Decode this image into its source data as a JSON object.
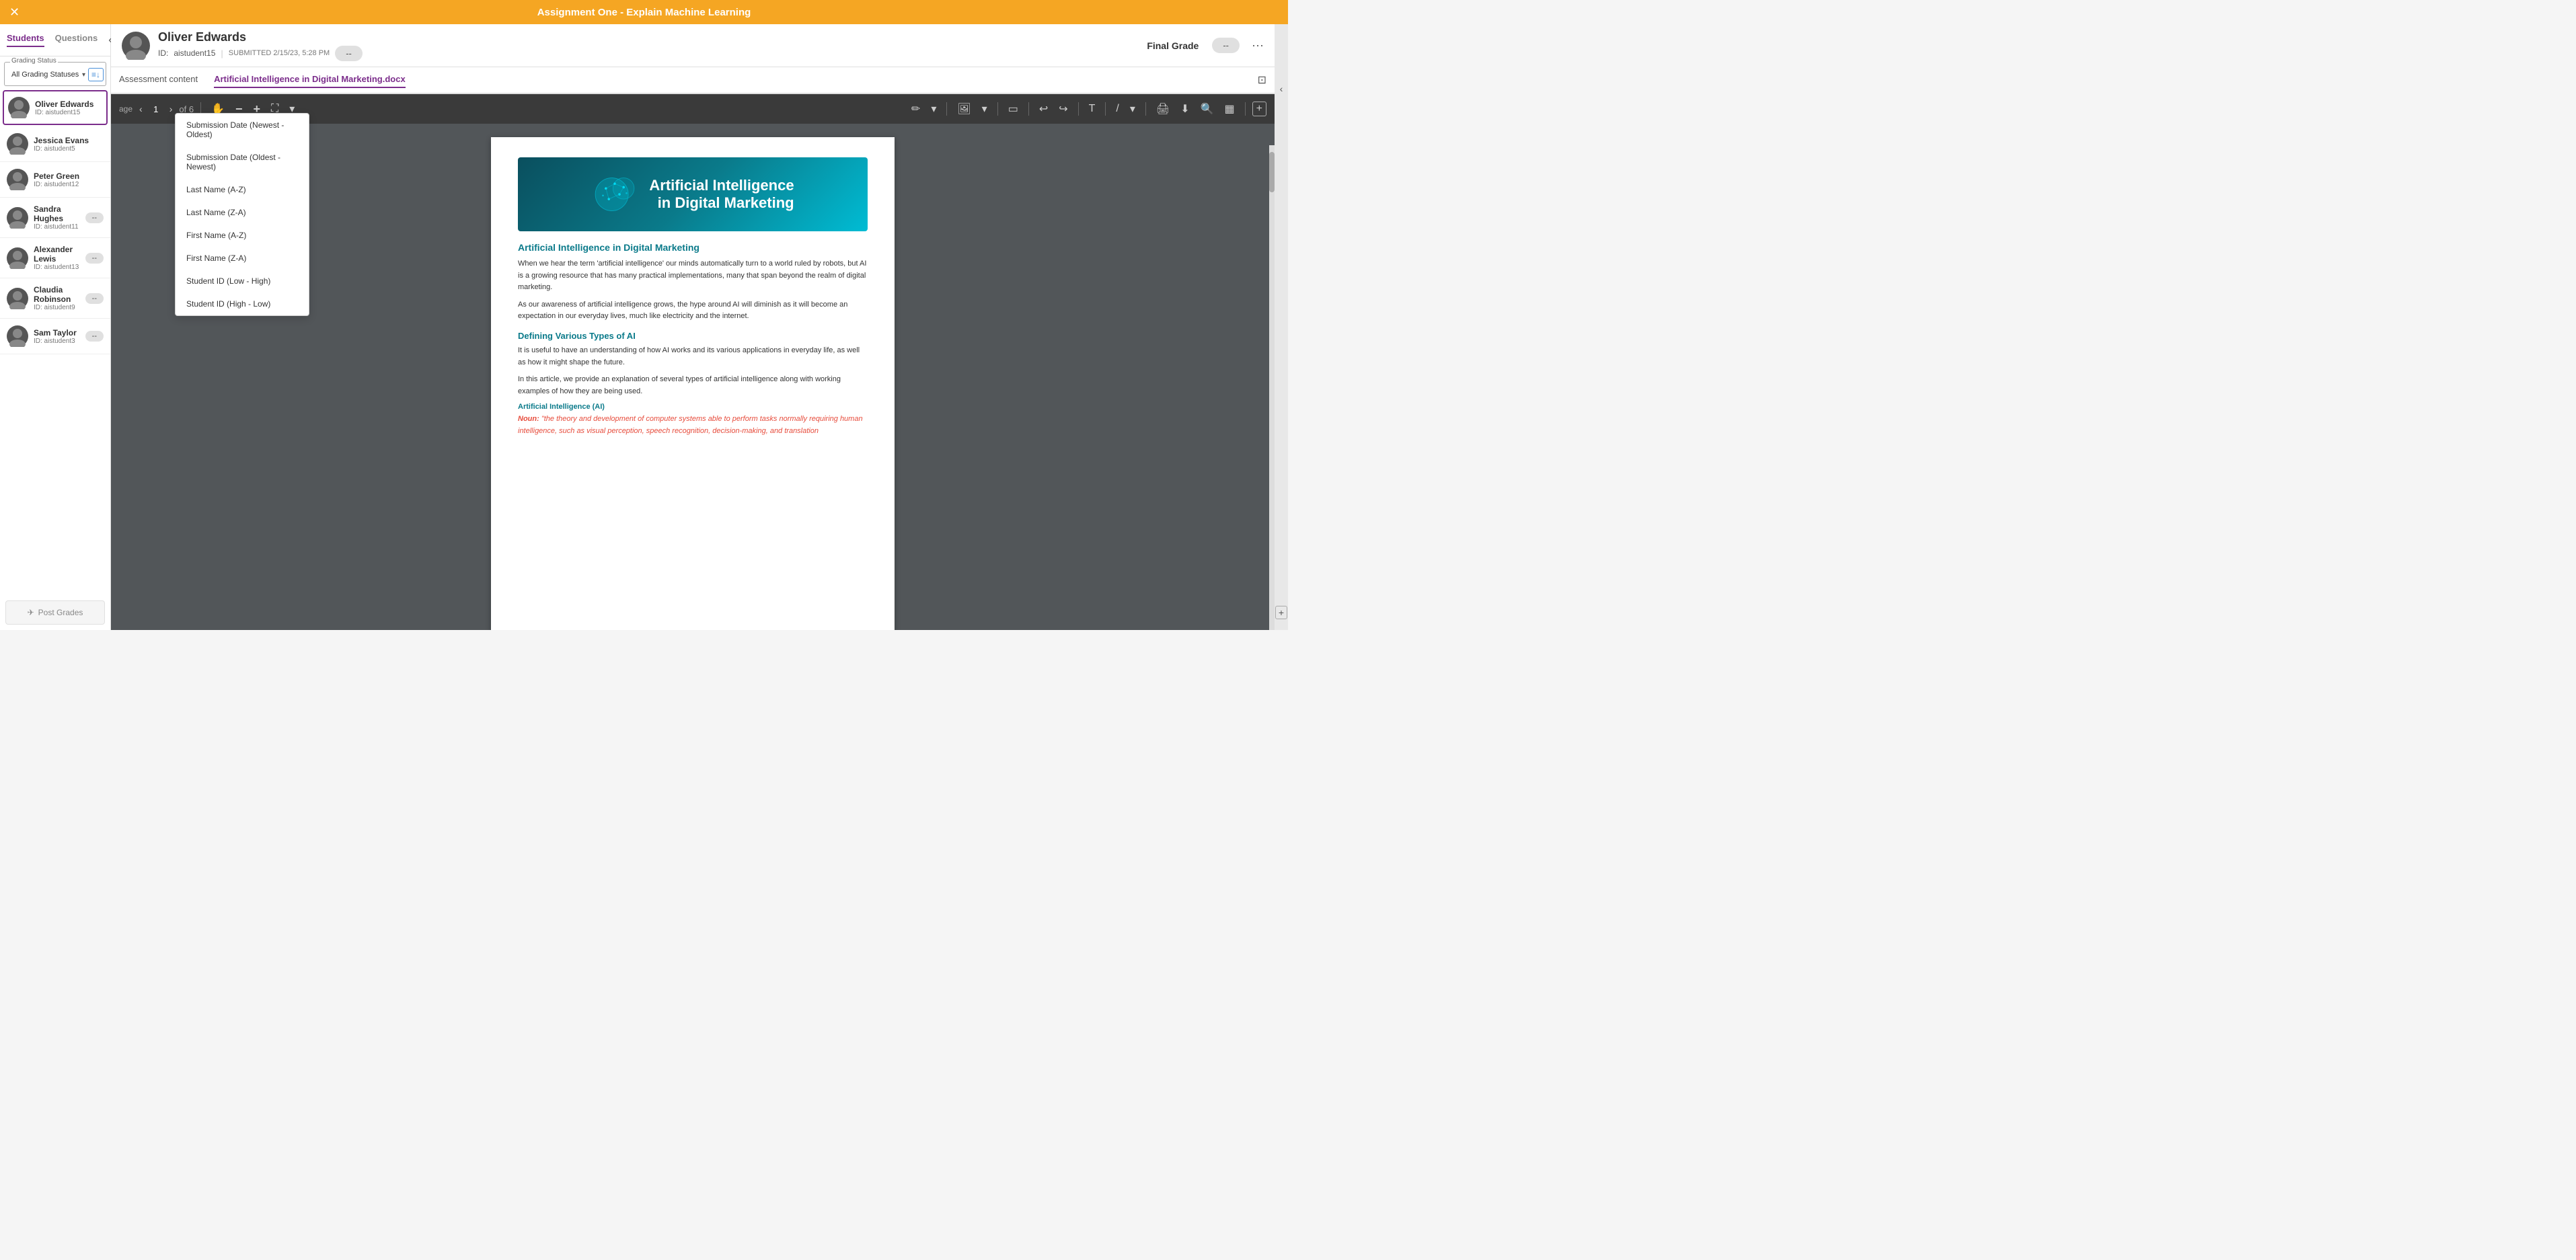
{
  "topBar": {
    "title": "Assignment One - Explain Machine Learning",
    "closeIcon": "✕"
  },
  "sidebar": {
    "tabs": [
      {
        "label": "Students",
        "active": true
      },
      {
        "label": "Questions",
        "active": false
      }
    ],
    "gradingStatusLabel": "Grading Status",
    "gradingStatusValue": "All Grading Statuses",
    "sortIcon": "≡↓",
    "students": [
      {
        "name": "Oliver Edwards",
        "id": "aistudent15",
        "grade": null,
        "active": true
      },
      {
        "name": "Jessica Evans",
        "id": "aistudent5",
        "grade": null,
        "active": false
      },
      {
        "name": "Peter Green",
        "id": "aistudent12",
        "grade": null,
        "active": false
      },
      {
        "name": "Sandra Hughes",
        "id": "aistudent11",
        "grade": "--",
        "active": false
      },
      {
        "name": "Alexander Lewis",
        "id": "aistudent13",
        "grade": "--",
        "active": false
      },
      {
        "name": "Claudia Robinson",
        "id": "aistudent9",
        "grade": "--",
        "active": false
      },
      {
        "name": "Sam Taylor",
        "id": "aistudent3",
        "grade": "--",
        "active": false
      }
    ],
    "postGradesBtn": "Post Grades"
  },
  "header": {
    "studentName": "Oliver Edwards",
    "idLabel": "ID:",
    "studentId": "aistudent15",
    "submittedLabel": "SUBMITTED 2/15/23, 5:28 PM",
    "gradeBtn": "--",
    "finalGradeLabel": "Final Grade",
    "finalGradeValue": "--",
    "moreIcon": "···"
  },
  "tabs": [
    {
      "label": "Assessment content",
      "active": false
    },
    {
      "label": "Artificial Intelligence in Digital Marketing.docx",
      "active": true
    }
  ],
  "pdfToolbar": {
    "prevPage": "‹",
    "nextPage": "›",
    "currentPage": "1",
    "ofSeparator": "of 6",
    "handIcon": "✋",
    "zoomOutIcon": "−",
    "zoomInIcon": "+",
    "fitIcon": "⛶",
    "dropdownIcon": "▾",
    "pencilIcon": "✏",
    "imageIcon": "🖼",
    "frameIcon": "▭",
    "undoIcon": "↩",
    "redoIcon": "↪",
    "textIcon": "T",
    "penIcon": "/",
    "printIcon": "🖨",
    "downloadIcon": "⬇",
    "searchIcon": "🔍",
    "chartIcon": "▦",
    "addIcon": "+"
  },
  "pdfContent": {
    "bannerTitle1": "Artificial Intelligence",
    "bannerTitle2": "in Digital Marketing",
    "h1": "Artificial Intelligence in Digital Marketing",
    "p1": "When we hear the term 'artificial intelligence' our minds automatically turn to a world ruled by robots, but AI is a growing resource that has many practical implementations, many that span beyond the realm of digital marketing.",
    "p2": "As our awareness of artificial intelligence grows, the hype around AI will diminish as it will become an expectation in our everyday lives, much like electricity and the internet.",
    "h2": "Defining Various Types of AI",
    "p3": "It is useful to have an understanding of how AI works and its various applications in everyday life, as well as how it might shape the future.",
    "p4": "In this article, we provide an explanation of several types of artificial intelligence along with working examples of how they are being used.",
    "subHeading": "Artificial Intelligence (AI)",
    "noun": "Noun:",
    "nounDef": "\"the theory and development of computer systems able to perform tasks normally requiring human intelligence, such as visual perception, speech recognition, decision-making, and translation"
  },
  "dropdown": {
    "items": [
      "Submission Date (Newest - Oldest)",
      "Submission Date (Oldest - Newest)",
      "Last Name (A-Z)",
      "Last Name (Z-A)",
      "First Name (A-Z)",
      "First Name (Z-A)",
      "Student ID (Low - High)",
      "Student ID (High - Low)"
    ]
  }
}
